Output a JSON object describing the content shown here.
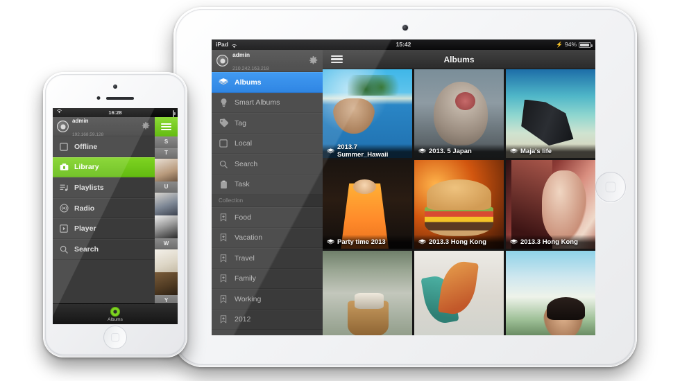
{
  "tablet": {
    "status_bar": {
      "device_label": "iPad",
      "wifi_icon": "wifi-icon",
      "time": "15:42",
      "battery_percent": "94%",
      "charging_icon": "charging-bolt-icon"
    },
    "account": {
      "name": "admin",
      "ip": "210.242.163.218",
      "avatar_icon": "user-avatar-icon",
      "settings_icon": "gear-icon"
    },
    "sidebar": {
      "items": [
        {
          "label": "Albums",
          "icon": "albums-stack-icon",
          "selected": true
        },
        {
          "label": "Smart Albums",
          "icon": "lightbulb-icon",
          "selected": false
        },
        {
          "label": "Tag",
          "icon": "tag-icon",
          "selected": false
        },
        {
          "label": "Local",
          "icon": "square-icon",
          "selected": false
        },
        {
          "label": "Search",
          "icon": "search-icon",
          "selected": false
        },
        {
          "label": "Task",
          "icon": "clipboard-icon",
          "selected": false
        }
      ],
      "section_header": "Collection",
      "collection": [
        {
          "label": "Food",
          "icon": "bookmark-star-icon"
        },
        {
          "label": "Vacation",
          "icon": "bookmark-star-icon"
        },
        {
          "label": "Travel",
          "icon": "bookmark-star-icon"
        },
        {
          "label": "Family",
          "icon": "bookmark-star-icon"
        },
        {
          "label": "Working",
          "icon": "bookmark-star-icon"
        },
        {
          "label": "2012",
          "icon": "bookmark-star-icon"
        }
      ]
    },
    "titlebar": {
      "menu_icon": "hamburger-icon",
      "title": "Albums"
    },
    "grid": [
      {
        "label": "2013.7 Summer_Hawaii",
        "icon": "albums-stack-icon",
        "art": "p-hawaii"
      },
      {
        "label": "2013. 5 Japan",
        "icon": "albums-stack-icon",
        "art": "p-japan"
      },
      {
        "label": "Maja's life",
        "icon": "albums-stack-icon",
        "art": "p-maja"
      },
      {
        "label": "Party time 2013",
        "icon": "albums-stack-icon",
        "art": "p-party"
      },
      {
        "label": "2013.3 Hong Kong",
        "icon": "albums-stack-icon",
        "art": "p-burger"
      },
      {
        "label": "2013.3 Hong Kong",
        "icon": "albums-stack-icon",
        "art": "p-hk1"
      },
      {
        "label": "",
        "icon": "",
        "art": "p-onsen"
      },
      {
        "label": "",
        "icon": "",
        "art": "p-leaf"
      },
      {
        "label": "",
        "icon": "",
        "art": "p-sky"
      }
    ]
  },
  "phone": {
    "status_bar": {
      "wifi_icon": "wifi-icon",
      "time": "16:28",
      "battery_icon": "battery-icon"
    },
    "account": {
      "name": "admin",
      "ip": "192.168.59.128",
      "avatar_icon": "user-avatar-icon",
      "settings_icon": "gear-icon"
    },
    "menu": [
      {
        "label": "Offline",
        "icon": "square-icon",
        "selected": false
      },
      {
        "label": "Library",
        "icon": "library-icon",
        "selected": true
      },
      {
        "label": "Playlists",
        "icon": "playlist-icon",
        "selected": false
      },
      {
        "label": "Radio",
        "icon": "radio-icon",
        "selected": false
      },
      {
        "label": "Player",
        "icon": "play-box-icon",
        "selected": false
      },
      {
        "label": "Search",
        "icon": "search-icon",
        "selected": false
      }
    ],
    "strip": {
      "menu_icon": "hamburger-icon",
      "sections": [
        {
          "letter": "S",
          "art": ""
        },
        {
          "letter": "T",
          "art": "a1"
        },
        {
          "letter": "U",
          "art": "a2"
        },
        {
          "letter": "",
          "art": "a3"
        },
        {
          "letter": "W",
          "art": "a4"
        },
        {
          "letter": "",
          "art": "a5"
        },
        {
          "letter": "Y",
          "art": "a6"
        }
      ]
    },
    "tabbar": {
      "icon": "green-disc-icon",
      "label": "Albums"
    }
  },
  "colors": {
    "accent_blue": "#1878e0",
    "accent_green": "#7ed321",
    "sidebar_bg": "#3a3a3a"
  }
}
